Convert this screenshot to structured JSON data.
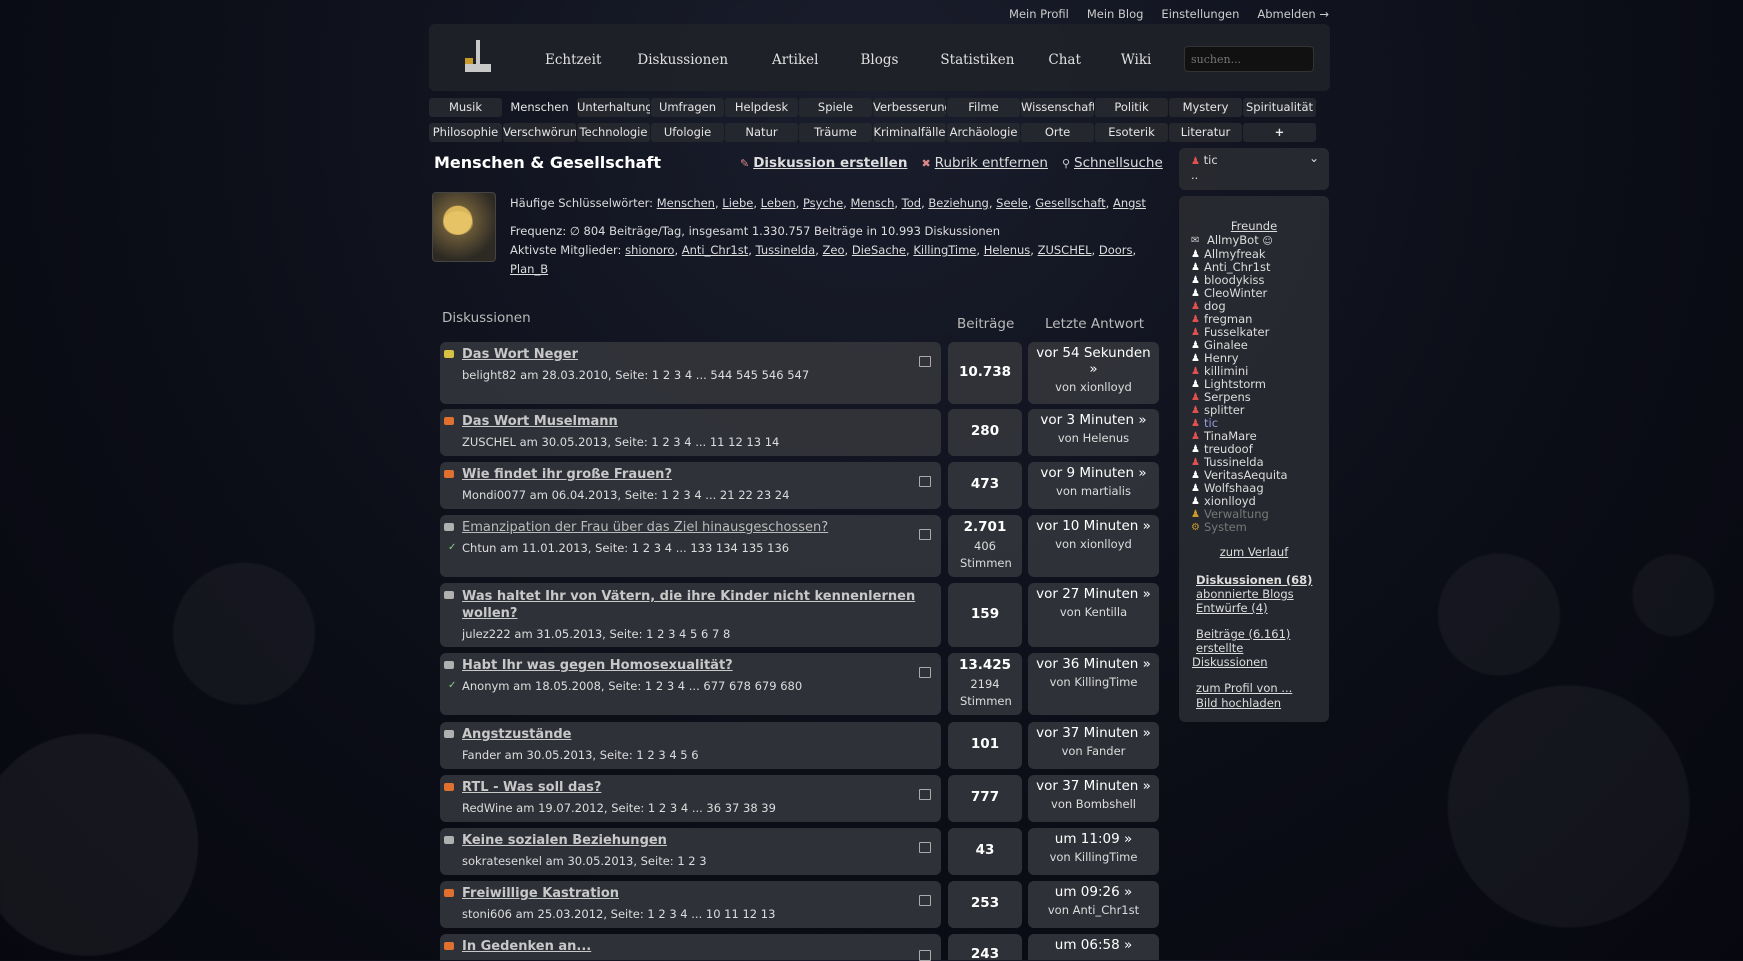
{
  "toplinks": [
    "Mein Profil",
    "Mein Blog",
    "Einstellungen",
    "Abmelden →"
  ],
  "mainnav": [
    "Echtzeit",
    "Diskussionen",
    "Artikel",
    "Blogs",
    "Statistiken",
    "Chat",
    "Wiki"
  ],
  "search": {
    "placeholder": "suchen..."
  },
  "categories_row1": [
    "Musik",
    "Menschen",
    "Unterhaltung",
    "Umfragen",
    "Helpdesk",
    "Spiele",
    "Verbesserungen",
    "Filme",
    "Wissenschaft",
    "Politik",
    "Mystery",
    "Spiritualität"
  ],
  "categories_row2": [
    "Philosophie",
    "Verschwörungen",
    "Technologie",
    "Ufologie",
    "Natur",
    "Träume",
    "Kriminalfälle",
    "Archäologie",
    "Orte",
    "Esoterik",
    "Literatur",
    "+"
  ],
  "page": {
    "title": "Menschen & Gesellschaft",
    "action_create": "Diskussion erstellen",
    "action_remove": "Rubrik entfernen",
    "action_search": "Schnellsuche"
  },
  "info": {
    "keywords_label": "Häufige Schlüsselwörter:",
    "keywords": [
      "Menschen",
      "Liebe",
      "Leben",
      "Psyche",
      "Mensch",
      "Tod",
      "Beziehung",
      "Seele",
      "Gesellschaft",
      "Angst"
    ],
    "frequency": "Frequenz: ∅ 804 Beiträge/Tag, insgesamt 1.330.757 Beiträge in 10.993 Diskussionen",
    "members_label": "Aktivste Mitglieder:",
    "members": [
      "shionoro",
      "Anti_Chr1st",
      "Tussinelda",
      "Zeo",
      "DieSache",
      "KillingTime",
      "Helenus",
      "ZUSCHEL",
      "Doors",
      "Plan_B"
    ]
  },
  "columns": {
    "discussions": "Diskussionen",
    "posts": "Beiträge",
    "last": "Letzte Antwort"
  },
  "threads": [
    {
      "title": "Das Wort Neger",
      "meta": "belight82 am 28.03.2010, Seite: 1 2 3 4 ... 544 545 546 547",
      "count": "10.738",
      "votes": "",
      "last1": "vor 54 Sekunden",
      "last2": "»",
      "by": "von xionlloyd",
      "icon": "y"
    },
    {
      "title": "Das Wort Muselmann",
      "meta": "ZUSCHEL am 30.05.2013, Seite: 1 2 3 4 ... 11 12 13 14",
      "count": "280",
      "votes": "",
      "last1": "vor 3 Minuten »",
      "last2": "",
      "by": "von Helenus",
      "icon": "o"
    },
    {
      "title": "Wie findet ihr große Frauen?",
      "meta": "Mondi0077 am 06.04.2013, Seite: 1 2 3 4 ... 21 22 23 24",
      "count": "473",
      "votes": "",
      "last1": "vor 9 Minuten »",
      "last2": "",
      "by": "von martialis",
      "icon": "o"
    },
    {
      "title": "Emanzipation der Frau über das Ziel hinausgeschossen?",
      "meta": "Chtun am 11.01.2013, Seite: 1 2 3 4 ... 133 134 135 136",
      "count": "2.701",
      "votes": "406 Stimmen",
      "last1": "vor 10 Minuten »",
      "last2": "",
      "by": "von xionlloyd",
      "icon": "p"
    },
    {
      "title": "Was haltet Ihr von Vätern, die ihre Kinder nicht kennenlernen wollen?",
      "meta": "julez222 am 31.05.2013, Seite: 1 2 3 4 5 6 7 8",
      "count": "159",
      "votes": "",
      "last1": "vor 27 Minuten »",
      "last2": "",
      "by": "von Kentilla",
      "icon": "p"
    },
    {
      "title": "Habt Ihr was gegen Homosexualität?",
      "meta": "Anonym am 18.05.2008, Seite: 1 2 3 4 ... 677 678 679 680",
      "count": "13.425",
      "votes": "2194 Stimmen",
      "last1": "vor 36 Minuten »",
      "last2": "",
      "by": "von KillingTime",
      "icon": "p"
    },
    {
      "title": "Angstzustände",
      "meta": "Fander am 30.05.2013, Seite: 1 2 3 4 5 6",
      "count": "101",
      "votes": "",
      "last1": "vor 37 Minuten »",
      "last2": "",
      "by": "von Fander",
      "icon": "p"
    },
    {
      "title": "RTL - Was soll das?",
      "meta": "RedWine am 19.07.2012, Seite: 1 2 3 4 ... 36 37 38 39",
      "count": "777",
      "votes": "",
      "last1": "vor 37 Minuten »",
      "last2": "",
      "by": "von Bombshell",
      "icon": "o"
    },
    {
      "title": "Keine sozialen Beziehungen",
      "meta": "sokratesenkel am 30.05.2013, Seite: 1 2 3",
      "count": "43",
      "votes": "",
      "last1": "um 11:09 »",
      "last2": "",
      "by": "von KillingTime",
      "icon": "p"
    },
    {
      "title": "Freiwillige Kastration",
      "meta": "stoni606 am 25.03.2012, Seite: 1 2 3 4 ... 10 11 12 13",
      "count": "253",
      "votes": "",
      "last1": "um 09:26 »",
      "last2": "",
      "by": "von Anti_Chr1st",
      "icon": "o"
    },
    {
      "title": "In Gedenken an...",
      "meta": "",
      "count": "243",
      "votes": "",
      "last1": "um 06:58 »",
      "last2": "",
      "by": "",
      "icon": "o"
    }
  ],
  "user": {
    "name": "tic",
    "dots": ".."
  },
  "sidebar": {
    "friends_title": "Freunde",
    "friends": [
      {
        "name": "AllmyBot",
        "status": "bot"
      },
      {
        "name": "Allmyfreak",
        "status": "on"
      },
      {
        "name": "Anti_Chr1st",
        "status": "on"
      },
      {
        "name": "bloodykiss",
        "status": "on"
      },
      {
        "name": "CleoWinter",
        "status": "on"
      },
      {
        "name": "dog",
        "status": "off"
      },
      {
        "name": "fregman",
        "status": "off"
      },
      {
        "name": "Fusselkater",
        "status": "off"
      },
      {
        "name": "Ginalee",
        "status": "on"
      },
      {
        "name": "Henry",
        "status": "on"
      },
      {
        "name": "killimini",
        "status": "off"
      },
      {
        "name": "Lightstorm",
        "status": "on"
      },
      {
        "name": "Serpens",
        "status": "off"
      },
      {
        "name": "splitter",
        "status": "off"
      },
      {
        "name": "tic",
        "status": "self"
      },
      {
        "name": "TinaMare",
        "status": "off"
      },
      {
        "name": "treudoof",
        "status": "on"
      },
      {
        "name": "Tussinelda",
        "status": "off"
      },
      {
        "name": "VeritasAequita",
        "status": "on"
      },
      {
        "name": "Wolfshaag",
        "status": "on"
      },
      {
        "name": "xionlloyd",
        "status": "on"
      },
      {
        "name": "Verwaltung",
        "status": "admin"
      },
      {
        "name": "System",
        "status": "system"
      }
    ],
    "history": "zum Verlauf",
    "discussions": "Diskussionen (68)",
    "blogs": "abonnierte Blogs",
    "drafts": "Entwürfe (4)",
    "posts": "Beiträge (6.161)",
    "created1": "erstellte",
    "created2": "Diskussionen",
    "profile": "zum Profil von ...",
    "upload": "Bild hochladen"
  },
  "colors": {
    "bg": "#0c0e18",
    "panel": "#323439",
    "accent_bot": "#c89a2a",
    "offline": "#e05050",
    "self": "#9a9ae0"
  }
}
